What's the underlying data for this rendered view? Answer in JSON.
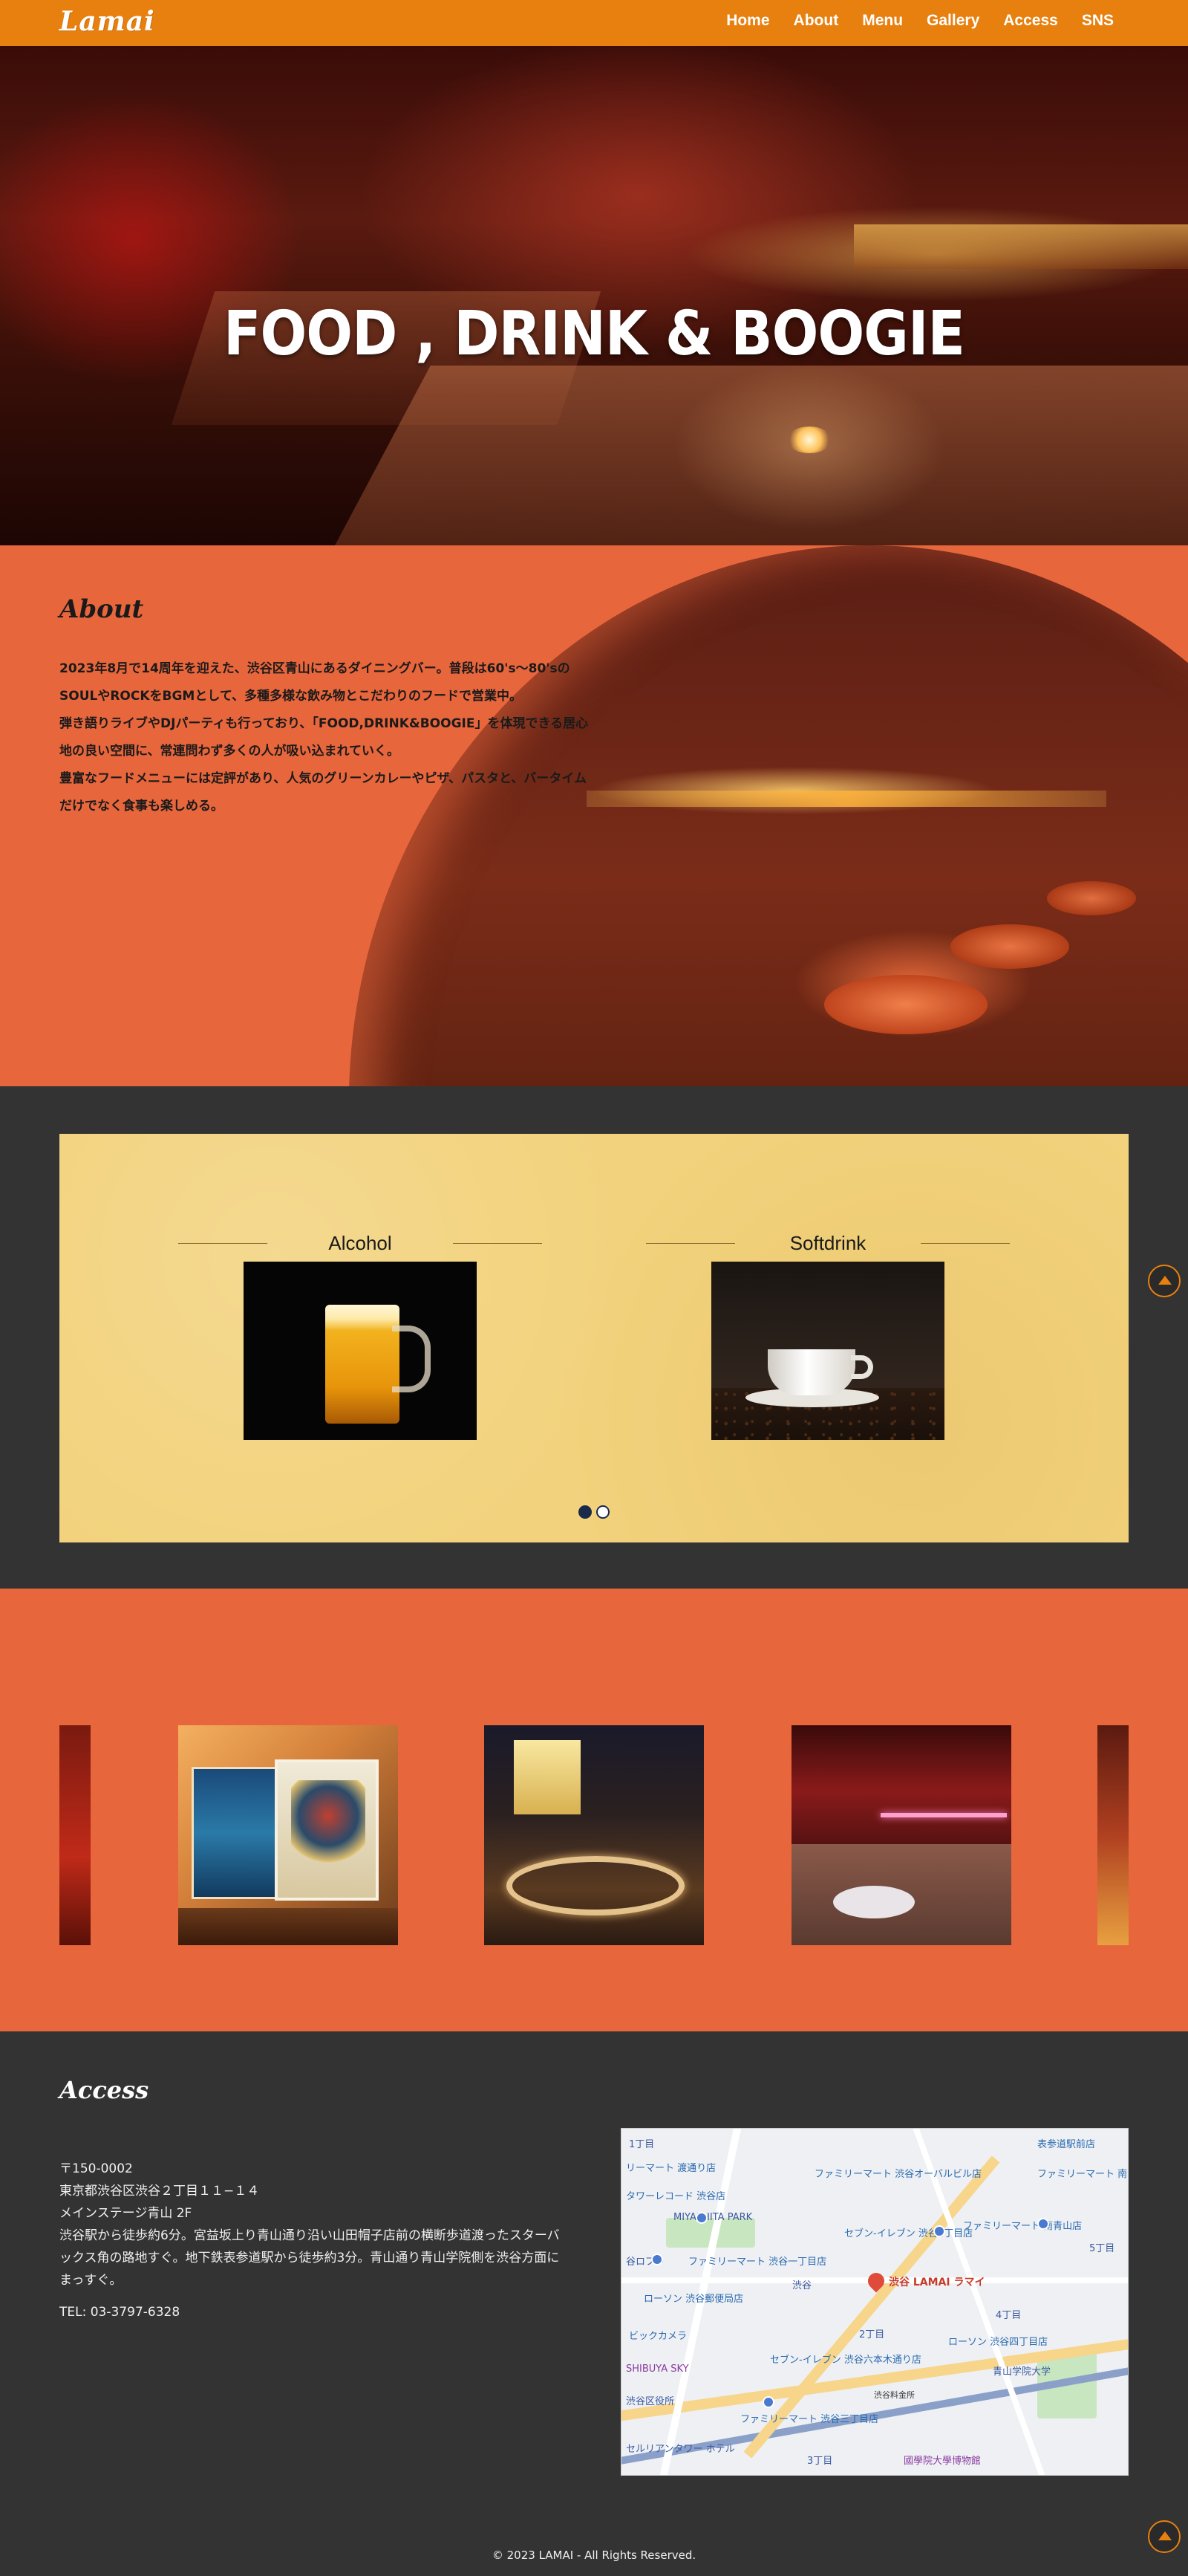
{
  "header": {
    "logo": "Lamai",
    "nav": [
      "Home",
      "About",
      "Menu",
      "Gallery",
      "Access",
      "SNS"
    ]
  },
  "hero": {
    "title": "FOOD , DRINK & BOOGIE"
  },
  "about": {
    "title": "About",
    "paragraphs": [
      "2023年8月で14周年を迎えた、渋谷区青山にあるダイニングバー。普段は60's〜80'sのSOULやROCKをBGMとして、多種多様な飲み物とこだわりのフードで営業中。",
      "弾き語りライブやDJパーティも行っており、「FOOD,DRINK&BOOGIE」を体現できる居心地の良い空間に、常連問わず多くの人が吸い込まれていく。",
      "豊富なフードメニューには定評があり、人気のグリーンカレーやピザ、パスタと、バータイムだけでなく食事も楽しめる。"
    ]
  },
  "menu": {
    "items": [
      {
        "label": "Alcohol"
      },
      {
        "label": "Softdrink"
      }
    ],
    "active_slide": 1,
    "slide_count": 2
  },
  "access": {
    "title": "Access",
    "postal": "〒150-0002",
    "address": "東京都渋谷区渋谷２丁目１１−１４",
    "building": "メインステージ青山 2F",
    "directions": "渋谷駅から徒歩約6分。宮益坂上り青山通り沿い山田帽子店前の横断歩道渡ったスターバックス角の路地すぐ。地下鉄表参道駅から徒歩約3分。青山通り青山学院側を渋谷方面にまっすぐ。",
    "tel": "TEL: 03-3797-6328",
    "map": {
      "shop_label": "渋谷 LAMAI ラマイ",
      "labels": [
        "1丁目",
        "ファミリーマート 渋谷オーバルビル店",
        "表参道駅前店",
        "ファミリーマート 南青山五丁目店",
        "リーマート 渡通り店",
        "タワーレコード 渋谷店",
        "MIYASHITA PARK",
        "セブン-イレブン 渋谷2丁目店",
        "ファミリーマート 南青山店",
        "谷ロフト",
        "ファミリーマート 渋谷一丁目店",
        "ローソン 渋谷郵便局店",
        "渋谷",
        "5丁目",
        "ローソン 渋谷四丁目店",
        "4丁目",
        "2丁目",
        "ビックカメラ",
        "青山学院大学",
        "セブン-イレブン 渋谷六本木通り店",
        "渋谷料金所",
        "國學院大學博物館",
        "3丁目",
        "ファミリーマート 渋谷三丁目店",
        "SHIBUYA SKY",
        "渋谷区役所",
        "セルリアンタワー ホテル"
      ]
    }
  },
  "footer": {
    "copyright": "© 2023 LAMAI - All Rights Reserved."
  },
  "colors": {
    "header": "#e8800f",
    "accent": "#e8663c",
    "dark": "#333333",
    "menu_card": "#f2d27c"
  }
}
